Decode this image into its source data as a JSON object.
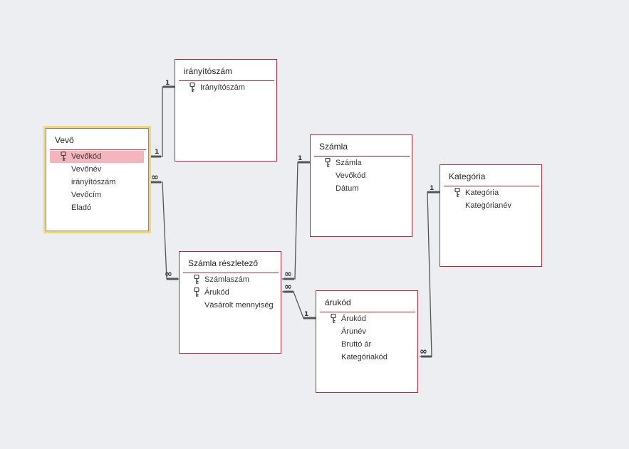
{
  "tables": {
    "vevo": {
      "title": "Vevő",
      "fields": [
        {
          "name": "Vevőkód",
          "key": true
        },
        {
          "name": "Vevőnév",
          "key": false
        },
        {
          "name": "irányítószám",
          "key": false
        },
        {
          "name": "Vevőcím",
          "key": false
        },
        {
          "name": "Eladó",
          "key": false
        }
      ]
    },
    "iranyitoszam": {
      "title": "irányítószám",
      "fields": [
        {
          "name": "Irányítószám",
          "key": true
        }
      ]
    },
    "szamla": {
      "title": "Számla",
      "fields": [
        {
          "name": "Számla",
          "key": true
        },
        {
          "name": "Vevőkód",
          "key": false
        },
        {
          "name": "Dátum",
          "key": false
        }
      ]
    },
    "kategoria": {
      "title": "Kategória",
      "fields": [
        {
          "name": "Kategória",
          "key": true
        },
        {
          "name": "Kategórianév",
          "key": false
        }
      ]
    },
    "szamla_reszletezo": {
      "title": "Számla részletező",
      "fields": [
        {
          "name": "Számlaszám",
          "key": true
        },
        {
          "name": "Árukód",
          "key": true
        },
        {
          "name": "Vásárolt mennyiség",
          "key": false
        }
      ]
    },
    "arukod": {
      "title": "árukód",
      "fields": [
        {
          "name": "Árukód",
          "key": true
        },
        {
          "name": "Árunév",
          "key": false
        },
        {
          "name": "Bruttó ár",
          "key": false
        },
        {
          "name": "Kategóriakód",
          "key": false
        }
      ]
    }
  },
  "relationships": {
    "one_label": "1",
    "many_label": "∞"
  },
  "colors": {
    "table_border": "#b5283a",
    "selected_glow": "#f5d66b",
    "highlight_row": "#f4b6bc",
    "line": "#555555",
    "background": "#eceef1"
  }
}
